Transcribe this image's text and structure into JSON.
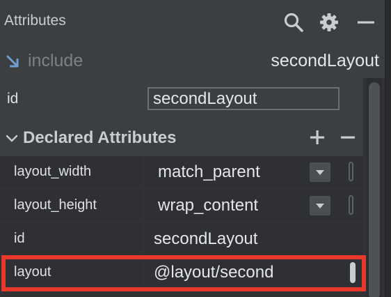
{
  "header": {
    "title": "Attributes",
    "icons": [
      "search-icon",
      "gear-icon",
      "minimize-icon"
    ]
  },
  "include": {
    "label": "include",
    "value": "secondLayout"
  },
  "id_field": {
    "label": "id",
    "value": "secondLayout"
  },
  "declared": {
    "title": "Declared Attributes",
    "add_icon": "plus-icon",
    "remove_icon": "minus-icon",
    "rows": [
      {
        "name": "layout_width",
        "value": "match_parent",
        "has_dropdown": true
      },
      {
        "name": "layout_height",
        "value": "wrap_content",
        "has_dropdown": true
      },
      {
        "name": "id",
        "value": "secondLayout",
        "has_dropdown": false
      },
      {
        "name": "layout",
        "value": "@layout/second",
        "has_dropdown": false
      }
    ]
  },
  "colors": {
    "highlight": "#e8372b",
    "panel": "#3c3f41",
    "table_cell": "#2e3033"
  }
}
